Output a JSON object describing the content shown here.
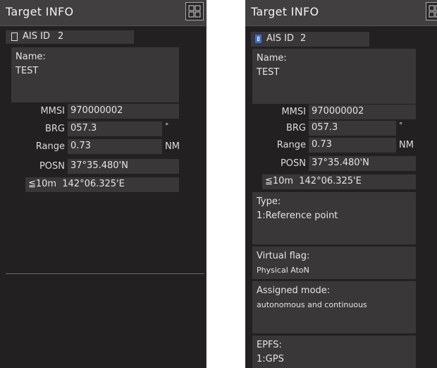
{
  "left": {
    "title": "Target INFO",
    "ais_id_label": "AIS ID",
    "ais_id": "2",
    "name_label": "Name:",
    "name": "TEST",
    "mmsi_label": "MMSI",
    "mmsi": "970000002",
    "brg_label": "BRG",
    "brg": "057.3",
    "brg_unit": "°",
    "range_label": "Range",
    "range": "0.73",
    "range_unit": "NM",
    "posn_label": "POSN",
    "lat": "37°35.480'N",
    "acc_label": "≦10m",
    "lon": "142°06.325'E"
  },
  "right": {
    "title": "Target INFO",
    "ais_id_label": "AIS ID",
    "ais_id": "2",
    "name_label": "Name:",
    "name": "TEST",
    "mmsi_label": "MMSI",
    "mmsi": "970000002",
    "brg_label": "BRG",
    "brg": "057.3",
    "brg_unit": "°",
    "range_label": "Range",
    "range": "0.73",
    "range_unit": "NM",
    "posn_label": "POSN",
    "lat": "37°35.480'N",
    "acc_label": "≦10m",
    "lon": "142°06.325'E",
    "type_label": "Type:",
    "type_value": "1:Reference point",
    "virtual_flag_label": "Virtual flag:",
    "virtual_flag_value": "Physical AtoN",
    "assigned_mode_label": "Assigned mode:",
    "assigned_mode_value": "autonomous and continuous",
    "epfs_label": "EPFS:",
    "epfs_value": "1:GPS",
    "ais_checkbox_checked": true,
    "accent_color": "#3b6fd6"
  }
}
